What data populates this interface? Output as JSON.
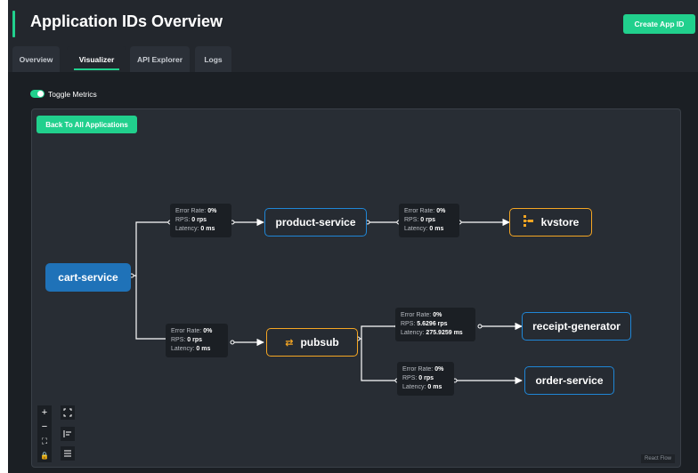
{
  "header": {
    "title": "Application IDs Overview",
    "create_button": "Create App ID"
  },
  "tabs": [
    "Overview",
    "Visualizer",
    "API Explorer",
    "Logs"
  ],
  "active_tab": "Visualizer",
  "toggle": {
    "label": "Toggle Metrics",
    "on": true
  },
  "back_button": "Back To All Applications",
  "nodes": {
    "cart": "cart-service",
    "product": "product-service",
    "kvstore": "kvstore",
    "pubsub": "pubsub",
    "receipt": "receipt-generator",
    "order": "order-service"
  },
  "metrics": {
    "labels": {
      "error": "Error Rate:",
      "rps": "RPS:",
      "latency": "Latency:"
    },
    "cart_product": {
      "error": "0%",
      "rps": "0 rps",
      "latency": "0 ms"
    },
    "product_kvstore": {
      "error": "0%",
      "rps": "0 rps",
      "latency": "0 ms"
    },
    "cart_pubsub": {
      "error": "0%",
      "rps": "0 rps",
      "latency": "0 ms"
    },
    "pubsub_receipt": {
      "error": "0%",
      "rps": "5.6296 rps",
      "latency": "275.9259 ms"
    },
    "pubsub_order": {
      "error": "0%",
      "rps": "0 rps",
      "latency": "0 ms"
    }
  },
  "controls": {
    "zoom_in": "+",
    "zoom_out": "−",
    "fit": "⛶",
    "lock": "🔒"
  },
  "attribution": "React Flow",
  "colors": {
    "accent": "#21d08d",
    "blue": "#1f86d6",
    "orange": "#f5a623",
    "node_fill": "#1f72b8"
  },
  "icons": {
    "kvstore": "kvstore-icon",
    "pubsub": "pubsub-icon"
  }
}
